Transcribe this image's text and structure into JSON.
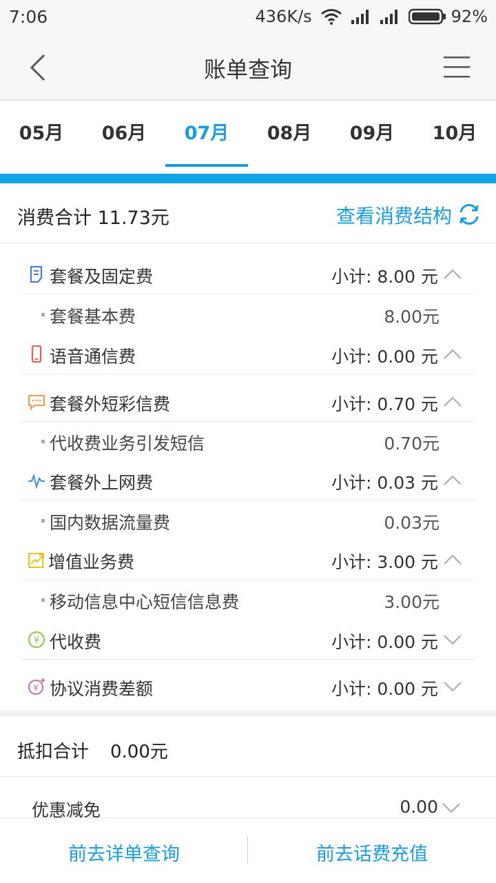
{
  "status_bar": {
    "time": "7:06",
    "speed": "436K/s",
    "battery": "92%"
  },
  "header": {
    "title": "账单查询"
  },
  "month_tabs": [
    {
      "label": "05月",
      "active": false
    },
    {
      "label": "06月",
      "active": false
    },
    {
      "label": "07月",
      "active": true
    },
    {
      "label": "08月",
      "active": false
    },
    {
      "label": "09月",
      "active": false
    },
    {
      "label": "10月",
      "active": false
    }
  ],
  "summary": {
    "total_label": "消费合计 11.73元",
    "structure_link": "查看消费结构"
  },
  "categories": [
    {
      "label": "套餐及固定费",
      "subtotal": "小计: 8.00 元",
      "icon": "doc-icon",
      "expanded": true,
      "color": "#4a7bd4",
      "items": [
        {
          "label": "套餐基本费",
          "amount": "8.00元"
        }
      ]
    },
    {
      "label": "语音通信费",
      "subtotal": "小计: 0.00 元",
      "icon": "phone-icon",
      "expanded": true,
      "color": "#f05a5a",
      "items": []
    },
    {
      "label": "套餐外短彩信费",
      "subtotal": "小计: 0.70 元",
      "icon": "message-icon",
      "expanded": true,
      "color": "#f39a4a",
      "items": [
        {
          "label": "代收费业务引发短信",
          "amount": "0.70元"
        }
      ]
    },
    {
      "label": "套餐外上网费",
      "subtotal": "小计: 0.03 元",
      "icon": "pulse-icon",
      "expanded": true,
      "color": "#3f8de0",
      "items": [
        {
          "label": "国内数据流量费",
          "amount": "0.03元"
        }
      ]
    },
    {
      "label": "增值业务费",
      "subtotal": "小计: 3.00 元",
      "icon": "trend-icon",
      "expanded": true,
      "color": "#f0c020",
      "items": [
        {
          "label": "移动信息中心短信信息费",
          "amount": "3.00元"
        }
      ]
    },
    {
      "label": "代收费",
      "subtotal": "小计: 0.00 元",
      "icon": "yen-circle-icon",
      "expanded": false,
      "color": "#8bc34a",
      "items": []
    },
    {
      "label": "协议消费差额",
      "subtotal": "小计: 0.00 元",
      "icon": "yen-sparkle-icon",
      "expanded": false,
      "color": "#c36bb7",
      "items": []
    }
  ],
  "deduction": {
    "label": "抵扣合计",
    "amount": "0.00元"
  },
  "discount": {
    "label": "优惠减免",
    "amount": "0.00"
  },
  "bottom_actions": {
    "detail": "前去详单查询",
    "recharge": "前去话费充值"
  }
}
